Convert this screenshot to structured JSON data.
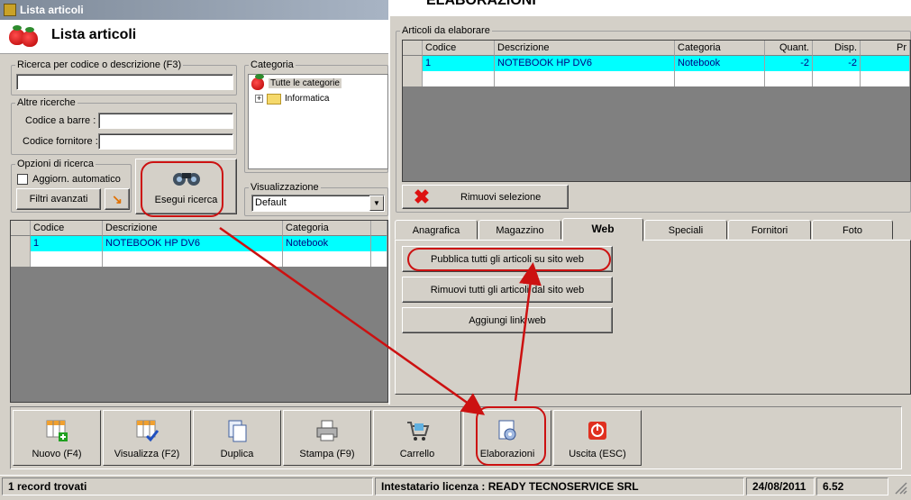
{
  "window": {
    "title": "Lista articoli",
    "header_title": "Lista articoli",
    "overlay_title": "ELABORAZIONI"
  },
  "search": {
    "code_desc_label": "Ricerca per codice o descrizione (F3)",
    "code_desc_value": "",
    "other_label": "Altre ricerche",
    "barcode_label": "Codice a barre :",
    "supplier_label": "Codice fornitore :",
    "options_label": "Opzioni di ricerca",
    "auto_update_label": "Aggiorn. automatico",
    "advanced_filters_label": "Filtri avanzati",
    "search_button_label": "Esegui ricerca"
  },
  "category": {
    "label": "Categoria",
    "items": [
      "Tutte le categorie",
      "Informatica"
    ]
  },
  "view": {
    "label": "Visualizzazione",
    "selected": "Default"
  },
  "left_table": {
    "columns": [
      "Codice",
      "Descrizione",
      "Categoria"
    ],
    "rows": [
      {
        "code": "1",
        "desc": "NOTEBOOK HP DV6",
        "cat": "Notebook"
      }
    ]
  },
  "right": {
    "articles_label": "Articoli da elaborare",
    "columns": [
      "Codice",
      "Descrizione",
      "Categoria",
      "Quant.",
      "Disp.",
      "Pr"
    ],
    "rows": [
      {
        "code": "1",
        "desc": "NOTEBOOK HP DV6",
        "cat": "Notebook",
        "qty": "-2",
        "disp": "-2"
      }
    ],
    "remove_selection_label": "Rimuovi selezione",
    "tabs": [
      "Anagrafica",
      "Magazzino",
      "Web",
      "Speciali",
      "Fornitori",
      "Foto"
    ],
    "active_tab": "Web",
    "web_buttons": [
      "Pubblica tutti gli articoli su sito web",
      "Rimuovi tutti gli articoli dal sito web",
      "Aggiungi link web"
    ]
  },
  "toolbar": {
    "buttons": [
      "Nuovo (F4)",
      "Visualizza (F2)",
      "Duplica",
      "Stampa (F9)",
      "Carrello",
      "Elaborazioni",
      "Uscita (ESC)"
    ]
  },
  "status": {
    "records": "1 record trovati",
    "license": "Intestatario licenza : READY TECNOSERVICE SRL",
    "date": "24/08/2011",
    "version": "6.52"
  },
  "colors": {
    "selection": "#00ffff",
    "annotation": "#cc1111"
  }
}
